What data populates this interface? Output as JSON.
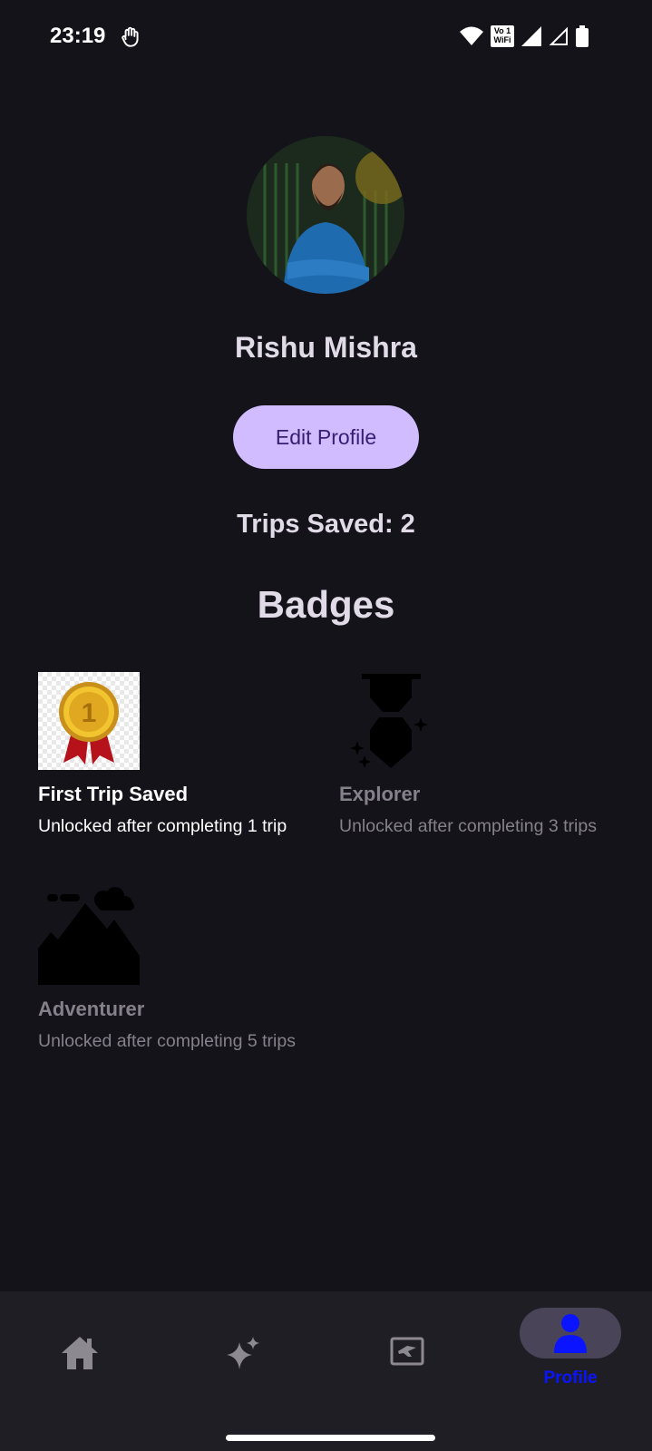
{
  "status_bar": {
    "time": "23:19",
    "network_badge": "Vo\n1\nWiFi"
  },
  "profile": {
    "name": "Rishu Mishra",
    "edit_button_label": "Edit Profile",
    "trips_saved": "Trips Saved: 2"
  },
  "badges": {
    "title": "Badges",
    "items": [
      {
        "name": "First Trip Saved",
        "description": "Unlocked after completing 1 trip",
        "unlocked": true,
        "icon": "gold-medal-icon"
      },
      {
        "name": "Explorer",
        "description": "Unlocked after completing 3 trips",
        "unlocked": false,
        "icon": "explorer-medal-icon"
      },
      {
        "name": "Adventurer",
        "description": "Unlocked after completing 5 trips",
        "unlocked": false,
        "icon": "mountain-icon"
      }
    ]
  },
  "bottom_nav": {
    "items": [
      {
        "icon": "home-icon",
        "label": ""
      },
      {
        "icon": "sparkles-icon",
        "label": ""
      },
      {
        "icon": "ticket-icon",
        "label": ""
      },
      {
        "icon": "person-icon",
        "label": "Profile",
        "selected": true
      }
    ]
  },
  "colors": {
    "background": "#15131a",
    "accent": "#d0bcff",
    "nav_selected_label": "#0a14ff",
    "nav_pill": "#4a4458"
  }
}
